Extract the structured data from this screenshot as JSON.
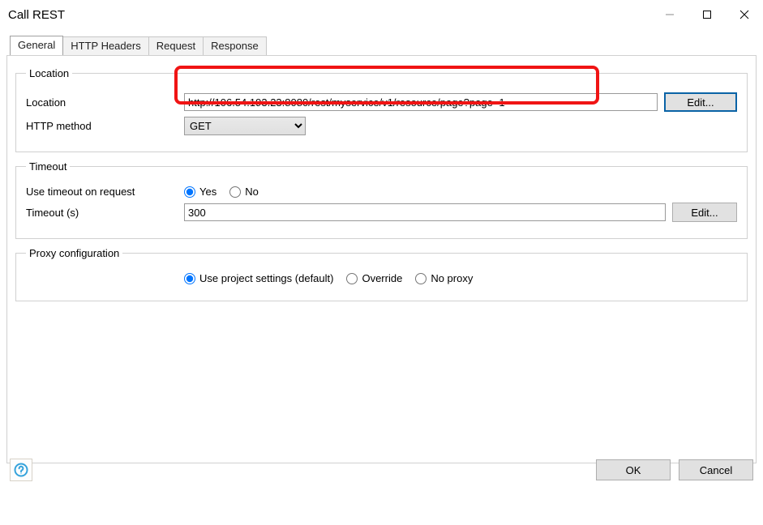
{
  "window": {
    "title": "Call REST"
  },
  "tabs": {
    "general": {
      "label": "General",
      "active": true
    },
    "headers": {
      "label": "HTTP Headers",
      "active": false
    },
    "request": {
      "label": "Request",
      "active": false
    },
    "response": {
      "label": "Response",
      "active": false
    }
  },
  "location": {
    "legend": "Location",
    "location_label": "Location",
    "location_value": "http://106.54.193.23:8080/rest/myservice/v1/resource/page?page=1",
    "edit_label": "Edit...",
    "http_method_label": "HTTP method",
    "http_method_value": "GET"
  },
  "timeout": {
    "legend": "Timeout",
    "use_timeout_label": "Use timeout on request",
    "option_yes": "Yes",
    "option_no": "No",
    "use_timeout_value": "yes",
    "timeout_label": "Timeout (s)",
    "timeout_value": "300",
    "edit_label": "Edit..."
  },
  "proxy": {
    "legend": "Proxy configuration",
    "option_default": "Use project settings (default)",
    "option_override": "Override",
    "option_noproxy": "No proxy",
    "value": "default"
  },
  "buttons": {
    "ok": "OK",
    "cancel": "Cancel"
  }
}
